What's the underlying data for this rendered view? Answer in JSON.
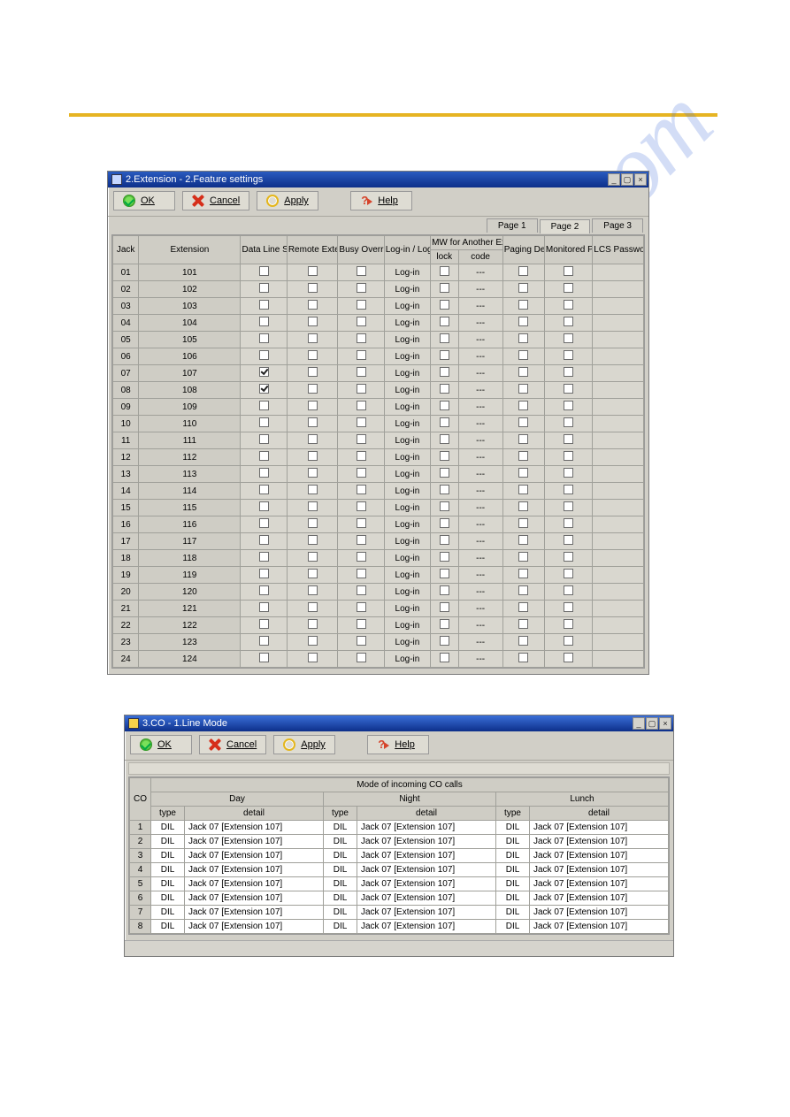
{
  "page": {
    "watermark": "manualslive.com"
  },
  "window1": {
    "title": "2.Extension - 2.Feature settings",
    "toolbar": {
      "ok": "OK",
      "cancel": "Cancel",
      "apply": "Apply",
      "help": "Help"
    },
    "tabs": [
      "Page 1",
      "Page 2",
      "Page 3"
    ],
    "active_tab": 1,
    "columns": {
      "jack": "Jack",
      "extension": "Extension",
      "data_line_security": "Data Line Security",
      "remote_ext_lock": "Remote Extension Lock",
      "busy_override_deny": "Busy Override Deny",
      "login_logout": "Log-in / Log-out",
      "mw_group": "MW for Another Ext. Lock",
      "mw_lock": "lock",
      "mw_code": "code",
      "paging_deny": "Paging Deny",
      "monitored_pt_set": "Monitored PT set",
      "lcs_password": "LCS Password"
    },
    "rows": [
      {
        "jack": "01",
        "ext": "101",
        "dls": false,
        "rel": false,
        "bod": false,
        "login": "Log-in",
        "mwl": false,
        "mwc": "---",
        "pd": false,
        "mpt": false,
        "lcs": ""
      },
      {
        "jack": "02",
        "ext": "102",
        "dls": false,
        "rel": false,
        "bod": false,
        "login": "Log-in",
        "mwl": false,
        "mwc": "---",
        "pd": false,
        "mpt": false,
        "lcs": ""
      },
      {
        "jack": "03",
        "ext": "103",
        "dls": false,
        "rel": false,
        "bod": false,
        "login": "Log-in",
        "mwl": false,
        "mwc": "---",
        "pd": false,
        "mpt": false,
        "lcs": ""
      },
      {
        "jack": "04",
        "ext": "104",
        "dls": false,
        "rel": false,
        "bod": false,
        "login": "Log-in",
        "mwl": false,
        "mwc": "---",
        "pd": false,
        "mpt": false,
        "lcs": ""
      },
      {
        "jack": "05",
        "ext": "105",
        "dls": false,
        "rel": false,
        "bod": false,
        "login": "Log-in",
        "mwl": false,
        "mwc": "---",
        "pd": false,
        "mpt": false,
        "lcs": ""
      },
      {
        "jack": "06",
        "ext": "106",
        "dls": false,
        "rel": false,
        "bod": false,
        "login": "Log-in",
        "mwl": false,
        "mwc": "---",
        "pd": false,
        "mpt": false,
        "lcs": ""
      },
      {
        "jack": "07",
        "ext": "107",
        "dls": true,
        "rel": false,
        "bod": false,
        "login": "Log-in",
        "mwl": false,
        "mwc": "---",
        "pd": false,
        "mpt": false,
        "lcs": ""
      },
      {
        "jack": "08",
        "ext": "108",
        "dls": true,
        "rel": false,
        "bod": false,
        "login": "Log-in",
        "mwl": false,
        "mwc": "---",
        "pd": false,
        "mpt": false,
        "lcs": ""
      },
      {
        "jack": "09",
        "ext": "109",
        "dls": false,
        "rel": false,
        "bod": false,
        "login": "Log-in",
        "mwl": false,
        "mwc": "---",
        "pd": false,
        "mpt": false,
        "lcs": ""
      },
      {
        "jack": "10",
        "ext": "110",
        "dls": false,
        "rel": false,
        "bod": false,
        "login": "Log-in",
        "mwl": false,
        "mwc": "---",
        "pd": false,
        "mpt": false,
        "lcs": ""
      },
      {
        "jack": "11",
        "ext": "111",
        "dls": false,
        "rel": false,
        "bod": false,
        "login": "Log-in",
        "mwl": false,
        "mwc": "---",
        "pd": false,
        "mpt": false,
        "lcs": ""
      },
      {
        "jack": "12",
        "ext": "112",
        "dls": false,
        "rel": false,
        "bod": false,
        "login": "Log-in",
        "mwl": false,
        "mwc": "---",
        "pd": false,
        "mpt": false,
        "lcs": ""
      },
      {
        "jack": "13",
        "ext": "113",
        "dls": false,
        "rel": false,
        "bod": false,
        "login": "Log-in",
        "mwl": false,
        "mwc": "---",
        "pd": false,
        "mpt": false,
        "lcs": ""
      },
      {
        "jack": "14",
        "ext": "114",
        "dls": false,
        "rel": false,
        "bod": false,
        "login": "Log-in",
        "mwl": false,
        "mwc": "---",
        "pd": false,
        "mpt": false,
        "lcs": ""
      },
      {
        "jack": "15",
        "ext": "115",
        "dls": false,
        "rel": false,
        "bod": false,
        "login": "Log-in",
        "mwl": false,
        "mwc": "---",
        "pd": false,
        "mpt": false,
        "lcs": ""
      },
      {
        "jack": "16",
        "ext": "116",
        "dls": false,
        "rel": false,
        "bod": false,
        "login": "Log-in",
        "mwl": false,
        "mwc": "---",
        "pd": false,
        "mpt": false,
        "lcs": ""
      },
      {
        "jack": "17",
        "ext": "117",
        "dls": false,
        "rel": false,
        "bod": false,
        "login": "Log-in",
        "mwl": false,
        "mwc": "---",
        "pd": false,
        "mpt": false,
        "lcs": ""
      },
      {
        "jack": "18",
        "ext": "118",
        "dls": false,
        "rel": false,
        "bod": false,
        "login": "Log-in",
        "mwl": false,
        "mwc": "---",
        "pd": false,
        "mpt": false,
        "lcs": ""
      },
      {
        "jack": "19",
        "ext": "119",
        "dls": false,
        "rel": false,
        "bod": false,
        "login": "Log-in",
        "mwl": false,
        "mwc": "---",
        "pd": false,
        "mpt": false,
        "lcs": ""
      },
      {
        "jack": "20",
        "ext": "120",
        "dls": false,
        "rel": false,
        "bod": false,
        "login": "Log-in",
        "mwl": false,
        "mwc": "---",
        "pd": false,
        "mpt": false,
        "lcs": ""
      },
      {
        "jack": "21",
        "ext": "121",
        "dls": false,
        "rel": false,
        "bod": false,
        "login": "Log-in",
        "mwl": false,
        "mwc": "---",
        "pd": false,
        "mpt": false,
        "lcs": ""
      },
      {
        "jack": "22",
        "ext": "122",
        "dls": false,
        "rel": false,
        "bod": false,
        "login": "Log-in",
        "mwl": false,
        "mwc": "---",
        "pd": false,
        "mpt": false,
        "lcs": ""
      },
      {
        "jack": "23",
        "ext": "123",
        "dls": false,
        "rel": false,
        "bod": false,
        "login": "Log-in",
        "mwl": false,
        "mwc": "---",
        "pd": false,
        "mpt": false,
        "lcs": ""
      },
      {
        "jack": "24",
        "ext": "124",
        "dls": false,
        "rel": false,
        "bod": false,
        "login": "Log-in",
        "mwl": false,
        "mwc": "---",
        "pd": false,
        "mpt": false,
        "lcs": ""
      }
    ]
  },
  "window2": {
    "title": "3.CO - 1.Line Mode",
    "toolbar": {
      "ok": "OK",
      "cancel": "Cancel",
      "apply": "Apply",
      "help": "Help"
    },
    "group_header": "Mode of incoming CO calls",
    "co_header": "CO",
    "periods": [
      "Day",
      "Night",
      "Lunch"
    ],
    "subcols": {
      "type": "type",
      "detail": "detail"
    },
    "rows": [
      {
        "co": "1",
        "day_t": "DIL",
        "day_d": "Jack 07 [Extension 107]",
        "night_t": "DIL",
        "night_d": "Jack 07 [Extension 107]",
        "lunch_t": "DIL",
        "lunch_d": "Jack 07 [Extension 107]"
      },
      {
        "co": "2",
        "day_t": "DIL",
        "day_d": "Jack 07 [Extension 107]",
        "night_t": "DIL",
        "night_d": "Jack 07 [Extension 107]",
        "lunch_t": "DIL",
        "lunch_d": "Jack 07 [Extension 107]"
      },
      {
        "co": "3",
        "day_t": "DIL",
        "day_d": "Jack 07 [Extension 107]",
        "night_t": "DIL",
        "night_d": "Jack 07 [Extension 107]",
        "lunch_t": "DIL",
        "lunch_d": "Jack 07 [Extension 107]"
      },
      {
        "co": "4",
        "day_t": "DIL",
        "day_d": "Jack 07 [Extension 107]",
        "night_t": "DIL",
        "night_d": "Jack 07 [Extension 107]",
        "lunch_t": "DIL",
        "lunch_d": "Jack 07 [Extension 107]"
      },
      {
        "co": "5",
        "day_t": "DIL",
        "day_d": "Jack 07 [Extension 107]",
        "night_t": "DIL",
        "night_d": "Jack 07 [Extension 107]",
        "lunch_t": "DIL",
        "lunch_d": "Jack 07 [Extension 107]"
      },
      {
        "co": "6",
        "day_t": "DIL",
        "day_d": "Jack 07 [Extension 107]",
        "night_t": "DIL",
        "night_d": "Jack 07 [Extension 107]",
        "lunch_t": "DIL",
        "lunch_d": "Jack 07 [Extension 107]"
      },
      {
        "co": "7",
        "day_t": "DIL",
        "day_d": "Jack 07 [Extension 107]",
        "night_t": "DIL",
        "night_d": "Jack 07 [Extension 107]",
        "lunch_t": "DIL",
        "lunch_d": "Jack 07 [Extension 107]"
      },
      {
        "co": "8",
        "day_t": "DIL",
        "day_d": "Jack 07 [Extension 107]",
        "night_t": "DIL",
        "night_d": "Jack 07 [Extension 107]",
        "lunch_t": "DIL",
        "lunch_d": "Jack 07 [Extension 107]"
      }
    ]
  }
}
